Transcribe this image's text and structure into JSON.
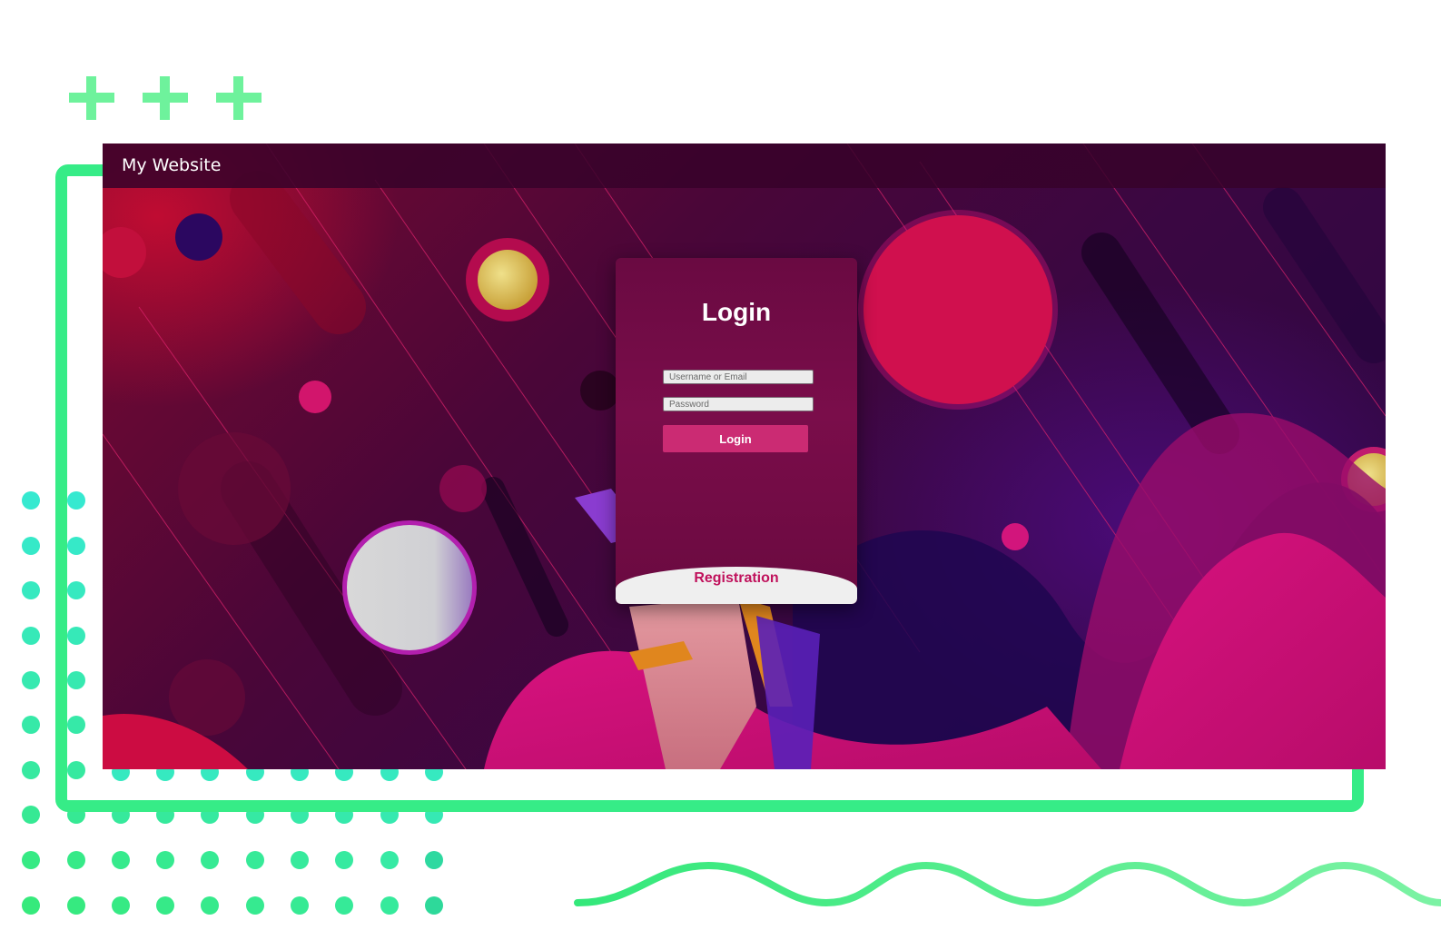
{
  "header": {
    "site_title": "My Website"
  },
  "login_form": {
    "title": "Login",
    "username_placeholder": "Username or Email",
    "password_placeholder": "Password",
    "submit_label": "Login",
    "registration_label": "Registration"
  },
  "colors": {
    "accent_green": "#36ec87",
    "dots_teal": "#2de8c8",
    "login_button": "#cb2b73",
    "registration_text": "#c0125c"
  }
}
